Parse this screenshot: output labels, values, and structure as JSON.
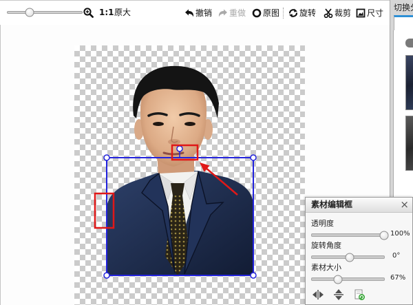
{
  "toolbar": {
    "zoom_slider_level": 0.3,
    "zoom_in_icon": "zoom-in-icon",
    "actual_size": {
      "ratio": "1:1",
      "label": "原大"
    },
    "undo": {
      "label": "撤销",
      "icon": "undo-icon",
      "enabled": true
    },
    "redo": {
      "label": "重做",
      "icon": "redo-icon",
      "enabled": false
    },
    "original": {
      "label": "原图",
      "icon": "original-circle-icon"
    },
    "rotate": {
      "label": "旋转",
      "icon": "rotate-icon"
    },
    "crop": {
      "label": "裁剪",
      "icon": "scissors-icon"
    },
    "size": {
      "label": "尺寸",
      "icon": "resize-icon"
    }
  },
  "side_panel": {
    "title": "切换分",
    "tab_accent": "#2d8fd5",
    "category_icon": "category-icon"
  },
  "canvas": {
    "selection_color": "#2222dd",
    "annotation_color": "#e01818"
  },
  "material_editor": {
    "title": "素材编辑框",
    "close_label": "×",
    "opacity": {
      "label": "透明度",
      "value": "100%",
      "level": 1.0
    },
    "rotation": {
      "label": "旋转角度",
      "value": "0°",
      "level": 0.52
    },
    "size": {
      "label": "素材大小",
      "value": "67%",
      "level": 0.36
    },
    "actions": [
      {
        "icon": "flip-horizontal-icon"
      },
      {
        "icon": "flip-vertical-icon"
      },
      {
        "icon": "duplicate-icon"
      }
    ]
  }
}
